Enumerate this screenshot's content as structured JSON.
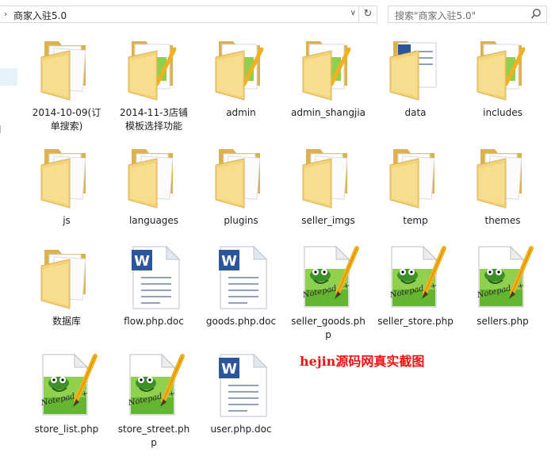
{
  "address": {
    "path": "商家入驻5.0"
  },
  "search": {
    "placeholder": "搜索\"商家入驻5.0\""
  },
  "watermark": "hejin源码网真实截图",
  "items": [
    {
      "name": "2014-10-09(订单搜索)",
      "type": "folder-generic"
    },
    {
      "name": "2014-11-3店铺模板选择功能",
      "type": "folder-notepad"
    },
    {
      "name": "admin",
      "type": "folder-notepad"
    },
    {
      "name": "admin_shangjia",
      "type": "folder-notepad"
    },
    {
      "name": "data",
      "type": "folder-word"
    },
    {
      "name": "includes",
      "type": "folder-notepad"
    },
    {
      "name": "js",
      "type": "folder-generic"
    },
    {
      "name": "languages",
      "type": "folder-generic"
    },
    {
      "name": "plugins",
      "type": "folder-generic"
    },
    {
      "name": "seller_imgs",
      "type": "folder-generic"
    },
    {
      "name": "temp",
      "type": "folder-generic"
    },
    {
      "name": "themes",
      "type": "folder-generic"
    },
    {
      "name": "数据库",
      "type": "folder-generic"
    },
    {
      "name": "flow.php.doc",
      "type": "word-doc"
    },
    {
      "name": "goods.php.doc",
      "type": "word-doc"
    },
    {
      "name": "seller_goods.php",
      "type": "notepad-php"
    },
    {
      "name": "seller_store.php",
      "type": "notepad-php"
    },
    {
      "name": "sellers.php",
      "type": "notepad-php"
    },
    {
      "name": "store_list.php",
      "type": "notepad-php"
    },
    {
      "name": "store_street.php",
      "type": "notepad-php"
    },
    {
      "name": "user.php.doc",
      "type": "word-doc"
    }
  ]
}
